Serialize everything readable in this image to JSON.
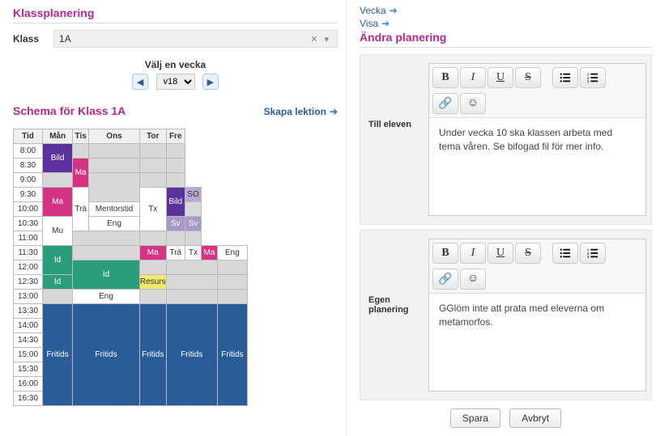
{
  "left": {
    "title": "Klassplanering",
    "klass_label": "Klass",
    "klass_value": "1A",
    "week_picker_title": "Välj en vecka",
    "week_value": "v18",
    "schedule_title": "Schema för Klass 1A",
    "create_lesson": "Skapa lektion",
    "day_headers": [
      "Tid",
      "Mån",
      "Tis",
      "Ons",
      "Tor",
      "Fre"
    ],
    "times": [
      "8:00",
      "8:30",
      "9:00",
      "9:30",
      "10:00",
      "10:30",
      "11:00",
      "11:30",
      "12:00",
      "12:30",
      "13:00",
      "13:30",
      "14:00",
      "14:30",
      "15:00",
      "15:30",
      "16:00",
      "16:30"
    ],
    "subjects": {
      "bild": "Bild",
      "ma": "Ma",
      "tra": "Trä",
      "tx": "Tx",
      "mentors": "Mentorstid",
      "so": "SO",
      "mu": "Mu",
      "eng": "Eng",
      "sv": "Sv",
      "id": "Id",
      "resurs": "Resurs",
      "fritids": "Fritids"
    }
  },
  "right": {
    "link_week": "Vecka",
    "link_show": "Visa",
    "title": "Ändra planering",
    "field1_label": "Till eleven",
    "field1_text": "Under vecka 10 ska klassen arbeta med tema våren. Se bifogad fil för mer info.",
    "field2_label": "Egen planering",
    "field2_text": "GGlöm inte att prata med eleverna om metamorfos.",
    "save": "Spara",
    "cancel": "Avbryt"
  }
}
